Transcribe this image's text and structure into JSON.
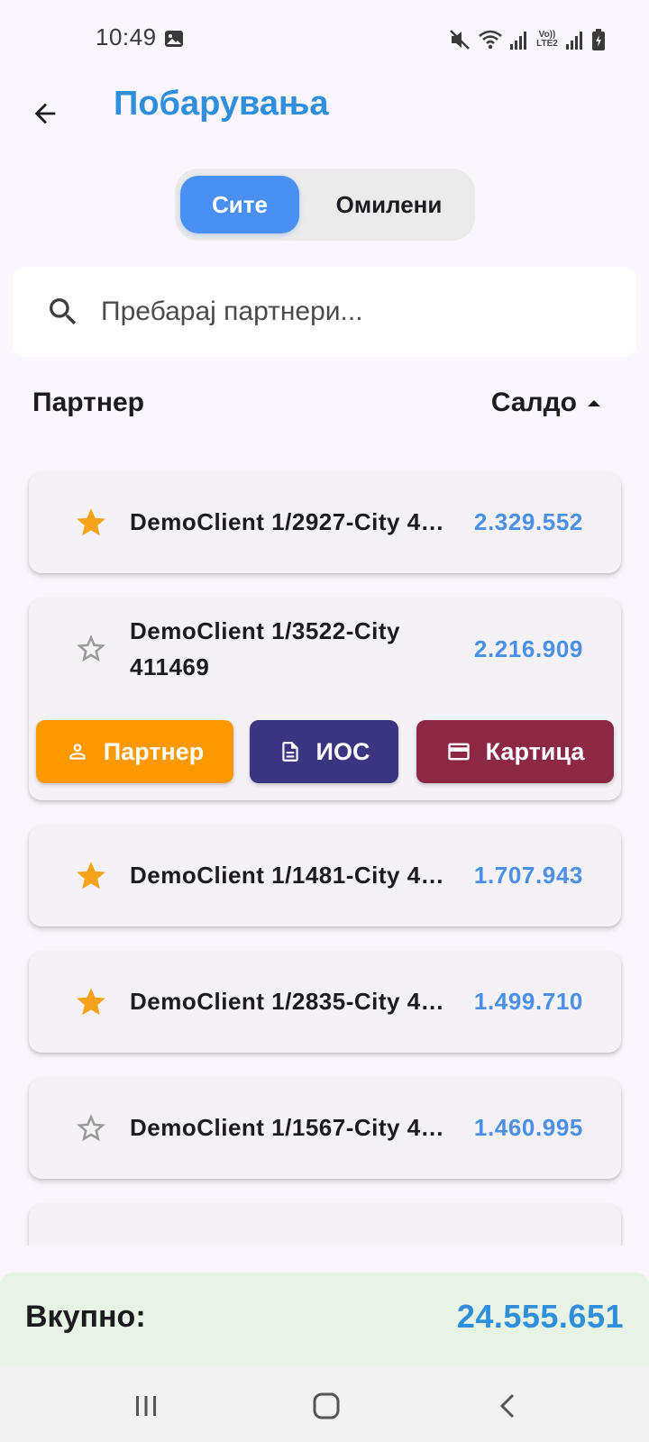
{
  "status_bar": {
    "time": "10:49",
    "icons": [
      "gallery-icon",
      "mute-icon",
      "wifi-icon",
      "signal-icon",
      "volte-icon",
      "signal-icon",
      "battery-icon"
    ],
    "volte_line1": "Vo))",
    "volte_line2": "LTE2"
  },
  "app_bar": {
    "title": "Побарувања",
    "back_icon": "arrow-back-icon",
    "title_color": "#2f8fdc"
  },
  "segments": {
    "all_label": "Сите",
    "favorites_label": "Омилени",
    "selected": "all",
    "accent": "#4a90f2"
  },
  "search": {
    "placeholder": "Пребарај партнери...",
    "value": ""
  },
  "columns": {
    "partner": "Партнер",
    "saldo": "Салдо",
    "sort_icon": "arrow-drop-up-icon"
  },
  "partners": [
    {
      "name": "DemoClient 1/2927-City 4…",
      "amount": "2.329.552",
      "favorite": true,
      "expanded": false
    },
    {
      "name": "DemoClient 1/3522-City 411469",
      "amount": "2.216.909",
      "favorite": false,
      "expanded": true
    },
    {
      "name": "DemoClient 1/1481-City 4…",
      "amount": "1.707.943",
      "favorite": true,
      "expanded": false
    },
    {
      "name": "DemoClient 1/2835-City 4…",
      "amount": "1.499.710",
      "favorite": true,
      "expanded": false
    },
    {
      "name": "DemoClient 1/1567-City 4…",
      "amount": "1.460.995",
      "favorite": false,
      "expanded": false
    }
  ],
  "actions": {
    "partner": "Партнер",
    "ios": "ИОС",
    "card": "Картица",
    "colors": {
      "partner": "#fe9800",
      "ios": "#3a3580",
      "card": "#8c2843"
    }
  },
  "total": {
    "label": "Вкупно:",
    "value": "24.555.651"
  },
  "nav": {
    "icons": [
      "recent-apps-icon",
      "home-icon",
      "nav-back-icon"
    ]
  }
}
